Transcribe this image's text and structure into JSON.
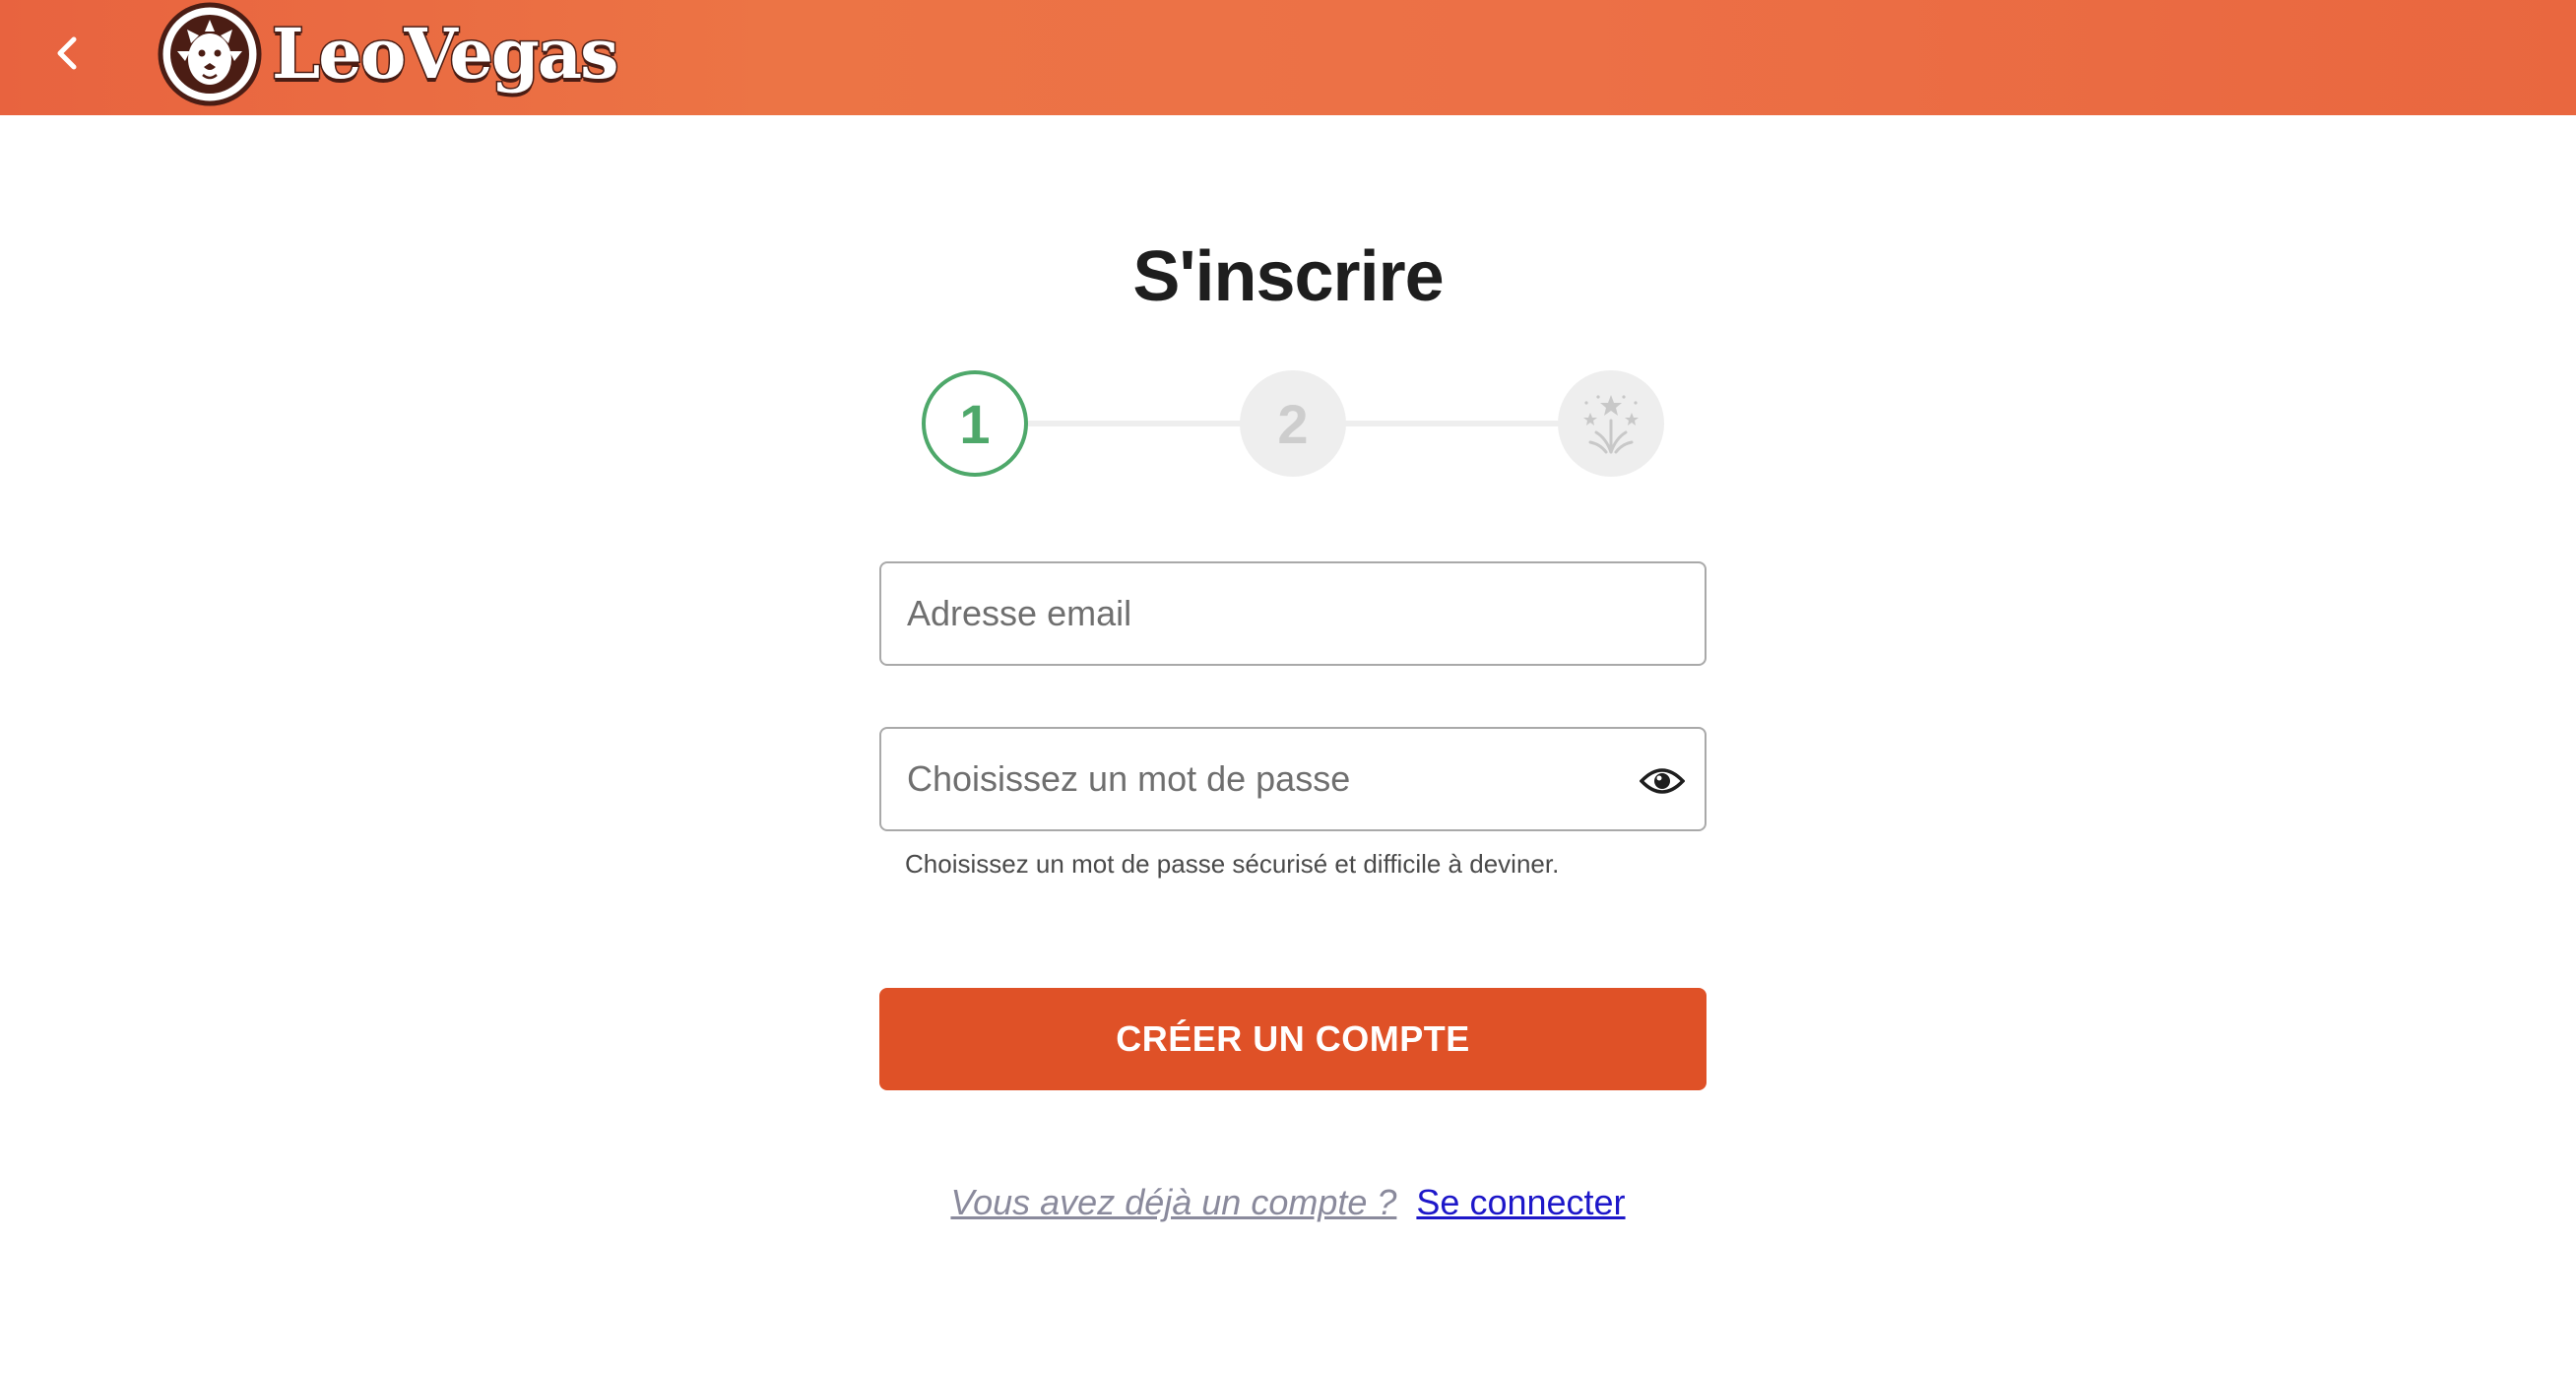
{
  "header": {
    "back_icon": "chevron-left-icon",
    "logo_text": "LeoVegas",
    "brand_color": "#e96a42"
  },
  "page": {
    "title": "S'inscrire"
  },
  "stepper": {
    "steps": [
      {
        "label": "1",
        "state": "active"
      },
      {
        "label": "2",
        "state": "inactive"
      },
      {
        "label": "",
        "icon": "fireworks-icon",
        "state": "inactive"
      }
    ],
    "active_color": "#4ea86a",
    "inactive_color": "#eeeeee"
  },
  "form": {
    "email": {
      "placeholder": "Adresse email",
      "value": ""
    },
    "password": {
      "placeholder": "Choisissez un mot de passe",
      "value": "",
      "toggle_icon": "eye-icon",
      "hint": "Choisissez un mot de passe sécurisé et difficile à deviner."
    },
    "submit_label": "CRÉER UN COMPTE",
    "submit_color": "#df5127"
  },
  "footer": {
    "question": "Vous avez déjà un compte ?",
    "login_link": "Se connecter"
  }
}
